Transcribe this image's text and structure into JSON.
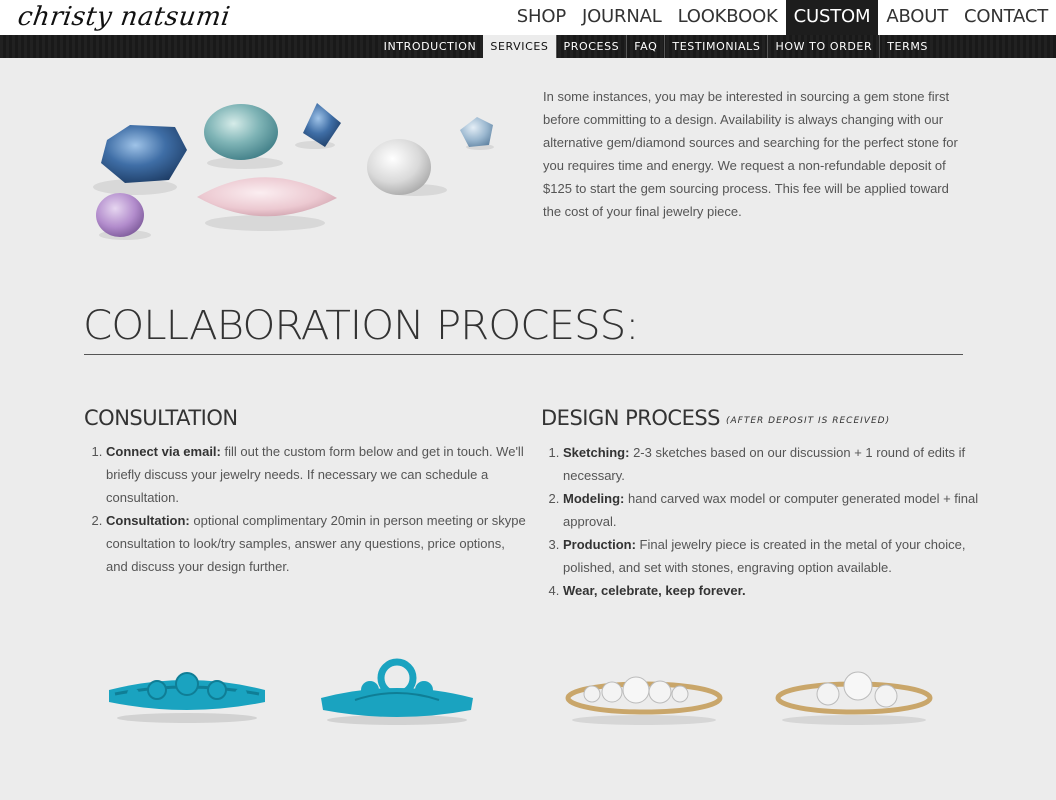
{
  "header": {
    "logo_text": "christy natsumi",
    "nav": [
      "SHOP",
      "JOURNAL",
      "LOOKBOOK",
      "CUSTOM",
      "ABOUT",
      "CONTACT"
    ],
    "active_nav": "CUSTOM"
  },
  "subnav": {
    "items": [
      "INTRODUCTION",
      "SERVICES",
      "PROCESS",
      "FAQ",
      "TESTIMONIALS",
      "HOW TO ORDER",
      "TERMS"
    ],
    "active": "SERVICES"
  },
  "intro": {
    "paragraph": "In some instances, you may be interested in sourcing a gem stone first before committing to a design. Availability is always changing with our alternative gem/diamond sources and searching for the perfect stone for you requires time and energy. We request a non-refundable deposit of $125 to start the gem sourcing process. This fee will be applied toward the cost of your final jewelry piece."
  },
  "collaboration": {
    "title": "COLLABORATION PROCESS:",
    "consultation": {
      "heading": "CONSULTATION",
      "items": [
        {
          "label": "Connect via email:",
          "text": " fill out the custom form below and get in touch. We'll briefly discuss your jewelry needs. If necessary we can schedule a consultation."
        },
        {
          "label": "Consultation:",
          "text": " optional complimentary 20min in person meeting or skype consultation to look/try samples, answer any questions, price options, and discuss your design further."
        }
      ]
    },
    "design": {
      "heading": "DESIGN PROCESS",
      "note": "(AFTER DEPOSIT IS RECEIVED)",
      "items": [
        {
          "label": "Sketching:",
          "text": " 2-3 sketches based on our discussion + 1 round of edits if necessary."
        },
        {
          "label": "Modeling:",
          "text": " hand carved wax model or computer generated model + final approval."
        },
        {
          "label": "Production:",
          "text": " Final jewelry piece is created in the metal of your choice, polished, and set with stones, engraving option available."
        },
        {
          "label": "Wear, celebrate, keep forever.",
          "text": ""
        }
      ]
    }
  },
  "colors": {
    "page_bg": "#ececec",
    "nav_active_bg": "#1d1d1d",
    "wax_blue": "#1aa3c0",
    "gold": "#c9a66a"
  }
}
